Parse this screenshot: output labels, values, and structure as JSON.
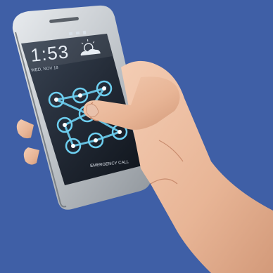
{
  "lockscreen": {
    "time": "1:53",
    "date": "WED, NOV 18",
    "emergency_call": "EMERGENCY CALL",
    "weather_icon": "sun-cloud-icon",
    "status_icons": [
      "wifi-icon",
      "signal-icon",
      "battery-icon"
    ],
    "status_time": "1:53"
  },
  "colors": {
    "background": "#3f5fa6",
    "screen": "#222a36",
    "pattern_line": "#6ecff0"
  }
}
